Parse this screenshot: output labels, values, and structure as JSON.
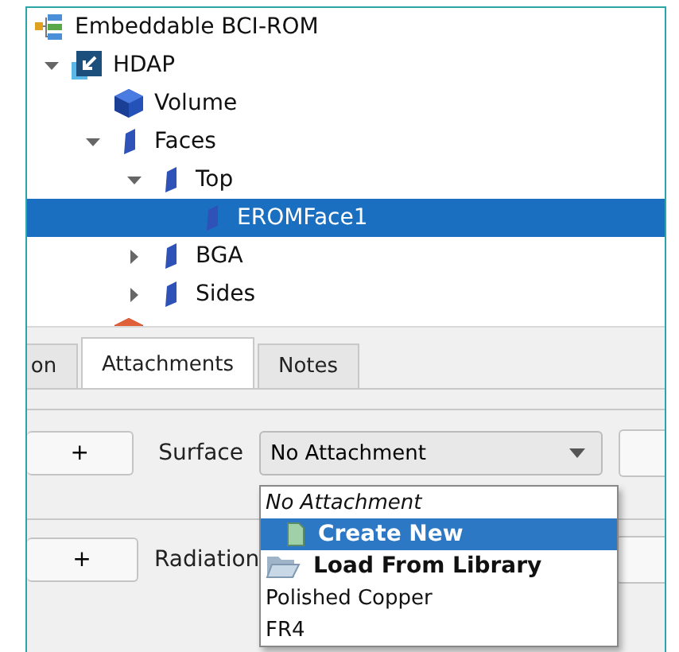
{
  "tree": {
    "items": [
      {
        "label": "Embeddable BCI-ROM",
        "kind": "assembly",
        "selected": false,
        "children": [
          {
            "label": "HDAP",
            "kind": "module",
            "expanded": true,
            "selected": false,
            "children": [
              {
                "label": "Volume",
                "kind": "volume",
                "selected": false
              },
              {
                "label": "Faces",
                "kind": "face",
                "expanded": true,
                "selected": false,
                "children": [
                  {
                    "label": "Top",
                    "kind": "face",
                    "expanded": true,
                    "selected": false,
                    "children": [
                      {
                        "label": "EROMFace1",
                        "kind": "face",
                        "selected": true
                      }
                    ]
                  },
                  {
                    "label": "BGA",
                    "kind": "face",
                    "expanded": false,
                    "selected": false
                  },
                  {
                    "label": "Sides",
                    "kind": "face",
                    "expanded": false,
                    "selected": false
                  }
                ]
              },
              {
                "kind": "source",
                "selected": false
              }
            ]
          }
        ]
      }
    ]
  },
  "tabs": [
    {
      "label": "on",
      "selected": false
    },
    {
      "label": "Attachments",
      "selected": true
    },
    {
      "label": "Notes",
      "selected": false
    }
  ],
  "rows": [
    {
      "button": "+",
      "label": "Surface",
      "combo": "No Attachment"
    },
    {
      "button": "+",
      "label": "Radiation"
    }
  ],
  "dropdown": {
    "items": [
      {
        "label": "No Attachment",
        "kind": "none",
        "selected": false
      },
      {
        "label": "Create New",
        "kind": "create",
        "selected": true
      },
      {
        "label": "Load From Library",
        "kind": "library",
        "selected": false
      },
      {
        "label": "Polished Copper",
        "kind": "material",
        "selected": false
      },
      {
        "label": "FR4",
        "kind": "material",
        "selected": false
      }
    ]
  }
}
